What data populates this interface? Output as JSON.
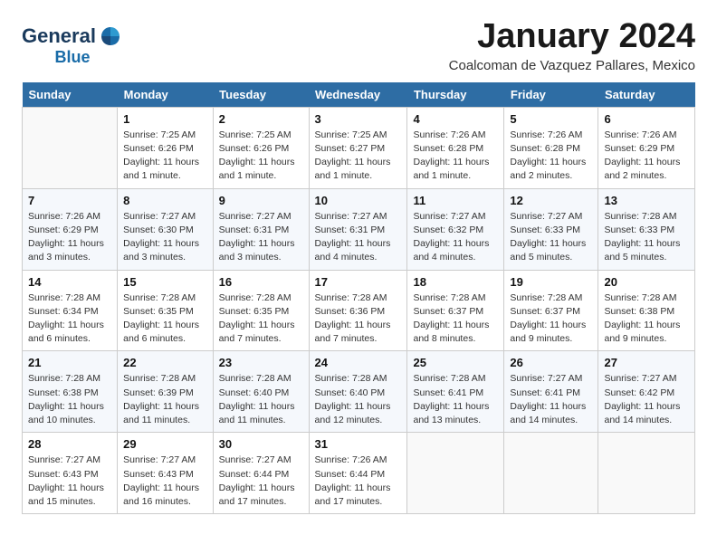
{
  "logo": {
    "text_general": "General",
    "text_blue": "Blue"
  },
  "title": "January 2024",
  "location": "Coalcoman de Vazquez Pallares, Mexico",
  "weekdays": [
    "Sunday",
    "Monday",
    "Tuesday",
    "Wednesday",
    "Thursday",
    "Friday",
    "Saturday"
  ],
  "weeks": [
    [
      {
        "day": "",
        "info": ""
      },
      {
        "day": "1",
        "info": "Sunrise: 7:25 AM\nSunset: 6:26 PM\nDaylight: 11 hours\nand 1 minute."
      },
      {
        "day": "2",
        "info": "Sunrise: 7:25 AM\nSunset: 6:26 PM\nDaylight: 11 hours\nand 1 minute."
      },
      {
        "day": "3",
        "info": "Sunrise: 7:25 AM\nSunset: 6:27 PM\nDaylight: 11 hours\nand 1 minute."
      },
      {
        "day": "4",
        "info": "Sunrise: 7:26 AM\nSunset: 6:28 PM\nDaylight: 11 hours\nand 1 minute."
      },
      {
        "day": "5",
        "info": "Sunrise: 7:26 AM\nSunset: 6:28 PM\nDaylight: 11 hours\nand 2 minutes."
      },
      {
        "day": "6",
        "info": "Sunrise: 7:26 AM\nSunset: 6:29 PM\nDaylight: 11 hours\nand 2 minutes."
      }
    ],
    [
      {
        "day": "7",
        "info": "Sunrise: 7:26 AM\nSunset: 6:29 PM\nDaylight: 11 hours\nand 3 minutes."
      },
      {
        "day": "8",
        "info": "Sunrise: 7:27 AM\nSunset: 6:30 PM\nDaylight: 11 hours\nand 3 minutes."
      },
      {
        "day": "9",
        "info": "Sunrise: 7:27 AM\nSunset: 6:31 PM\nDaylight: 11 hours\nand 3 minutes."
      },
      {
        "day": "10",
        "info": "Sunrise: 7:27 AM\nSunset: 6:31 PM\nDaylight: 11 hours\nand 4 minutes."
      },
      {
        "day": "11",
        "info": "Sunrise: 7:27 AM\nSunset: 6:32 PM\nDaylight: 11 hours\nand 4 minutes."
      },
      {
        "day": "12",
        "info": "Sunrise: 7:27 AM\nSunset: 6:33 PM\nDaylight: 11 hours\nand 5 minutes."
      },
      {
        "day": "13",
        "info": "Sunrise: 7:28 AM\nSunset: 6:33 PM\nDaylight: 11 hours\nand 5 minutes."
      }
    ],
    [
      {
        "day": "14",
        "info": "Sunrise: 7:28 AM\nSunset: 6:34 PM\nDaylight: 11 hours\nand 6 minutes."
      },
      {
        "day": "15",
        "info": "Sunrise: 7:28 AM\nSunset: 6:35 PM\nDaylight: 11 hours\nand 6 minutes."
      },
      {
        "day": "16",
        "info": "Sunrise: 7:28 AM\nSunset: 6:35 PM\nDaylight: 11 hours\nand 7 minutes."
      },
      {
        "day": "17",
        "info": "Sunrise: 7:28 AM\nSunset: 6:36 PM\nDaylight: 11 hours\nand 7 minutes."
      },
      {
        "day": "18",
        "info": "Sunrise: 7:28 AM\nSunset: 6:37 PM\nDaylight: 11 hours\nand 8 minutes."
      },
      {
        "day": "19",
        "info": "Sunrise: 7:28 AM\nSunset: 6:37 PM\nDaylight: 11 hours\nand 9 minutes."
      },
      {
        "day": "20",
        "info": "Sunrise: 7:28 AM\nSunset: 6:38 PM\nDaylight: 11 hours\nand 9 minutes."
      }
    ],
    [
      {
        "day": "21",
        "info": "Sunrise: 7:28 AM\nSunset: 6:38 PM\nDaylight: 11 hours\nand 10 minutes."
      },
      {
        "day": "22",
        "info": "Sunrise: 7:28 AM\nSunset: 6:39 PM\nDaylight: 11 hours\nand 11 minutes."
      },
      {
        "day": "23",
        "info": "Sunrise: 7:28 AM\nSunset: 6:40 PM\nDaylight: 11 hours\nand 11 minutes."
      },
      {
        "day": "24",
        "info": "Sunrise: 7:28 AM\nSunset: 6:40 PM\nDaylight: 11 hours\nand 12 minutes."
      },
      {
        "day": "25",
        "info": "Sunrise: 7:28 AM\nSunset: 6:41 PM\nDaylight: 11 hours\nand 13 minutes."
      },
      {
        "day": "26",
        "info": "Sunrise: 7:27 AM\nSunset: 6:41 PM\nDaylight: 11 hours\nand 14 minutes."
      },
      {
        "day": "27",
        "info": "Sunrise: 7:27 AM\nSunset: 6:42 PM\nDaylight: 11 hours\nand 14 minutes."
      }
    ],
    [
      {
        "day": "28",
        "info": "Sunrise: 7:27 AM\nSunset: 6:43 PM\nDaylight: 11 hours\nand 15 minutes."
      },
      {
        "day": "29",
        "info": "Sunrise: 7:27 AM\nSunset: 6:43 PM\nDaylight: 11 hours\nand 16 minutes."
      },
      {
        "day": "30",
        "info": "Sunrise: 7:27 AM\nSunset: 6:44 PM\nDaylight: 11 hours\nand 17 minutes."
      },
      {
        "day": "31",
        "info": "Sunrise: 7:26 AM\nSunset: 6:44 PM\nDaylight: 11 hours\nand 17 minutes."
      },
      {
        "day": "",
        "info": ""
      },
      {
        "day": "",
        "info": ""
      },
      {
        "day": "",
        "info": ""
      }
    ]
  ]
}
